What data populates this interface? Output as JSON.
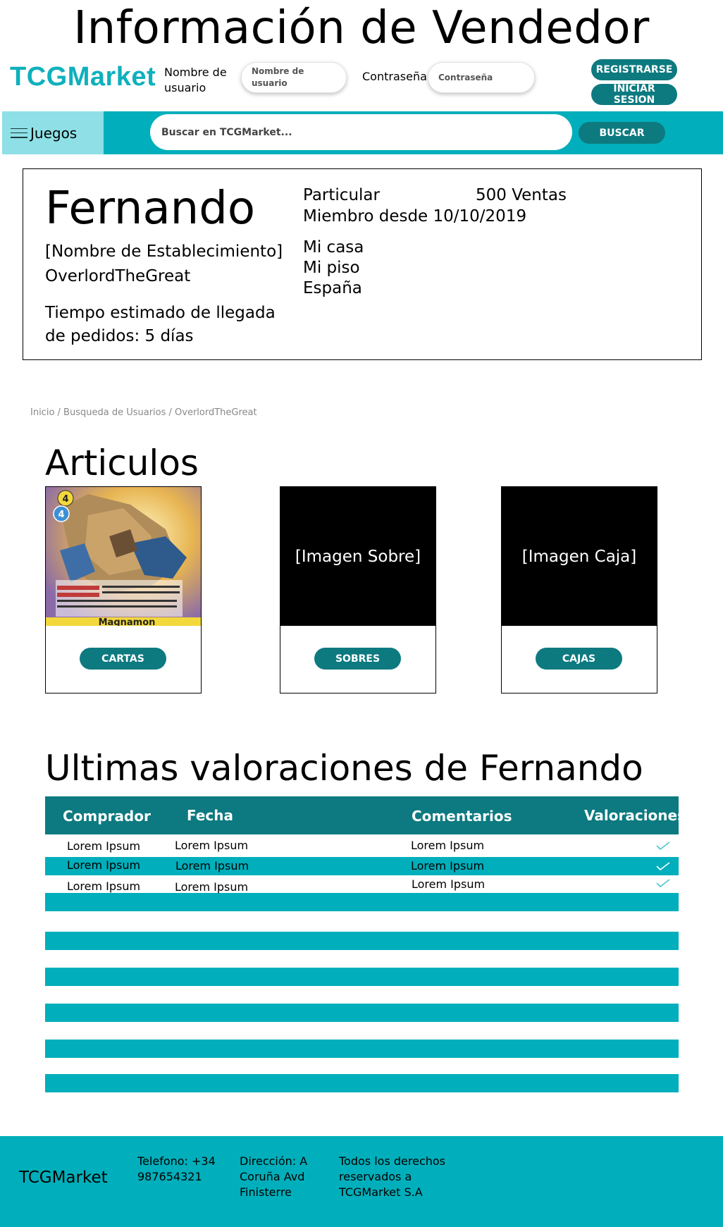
{
  "page_title": "Información de Vendedor",
  "header": {
    "brand": "TCGMarket",
    "username_label": "Nombre de usuario",
    "username_placeholder": "Nombre de usuario",
    "password_label": "Contraseña:",
    "password_placeholder": "Contraseña",
    "register_label": "REGISTRARSE",
    "login_label": "INICIAR SESION"
  },
  "nav": {
    "games_label": "Juegos",
    "search_placeholder": "Buscar en TCGMarket...",
    "search_button": "BUSCAR"
  },
  "seller": {
    "name": "Fernando",
    "establishment": "[Nombre de Establecimiento]",
    "username": "OverlordTheGreat",
    "eta": "Tiempo estimado de llegada de pedidos: 5 días",
    "type": "Particular",
    "sales": "500 Ventas",
    "member_since": "Miembro desde 10/10/2019",
    "address": [
      "Mi casa",
      "Mi piso",
      "España"
    ]
  },
  "breadcrumb": "Inicio / Busqueda de Usuarios / OverlordTheGreat",
  "articles": {
    "title": "Articulos",
    "cards": [
      {
        "image_label": "",
        "button": "CARTAS",
        "card_name": "Magnamon"
      },
      {
        "image_label": "[Imagen Sobre]",
        "button": "SOBRES"
      },
      {
        "image_label": "[Imagen Caja]",
        "button": "CAJAS"
      }
    ]
  },
  "ratings": {
    "title": "Ultimas valoraciones de Fernando",
    "columns": [
      "Comprador",
      "Fecha",
      "Comentarios",
      "Valoraciones"
    ],
    "rows": [
      {
        "buyer": "Lorem Ipsum",
        "date": "Lorem Ipsum",
        "comment": "Lorem Ipsum",
        "rating_icon": "check-icon"
      },
      {
        "buyer": "Lorem Ipsum",
        "date": "Lorem Ipsum",
        "comment": "Lorem Ipsum",
        "rating_icon": "check-icon"
      },
      {
        "buyer": "Lorem Ipsum",
        "date": "Lorem Ipsum",
        "comment": "Lorem Ipsum",
        "rating_icon": "check-icon"
      }
    ]
  },
  "footer": {
    "brand": "TCGMarket",
    "phone": "Telefono: +34 987654321",
    "address": "Dirección: A Coruña Avd Finisterre",
    "rights": "Todos los derechos reservados a TCGMarket S.A"
  },
  "colors": {
    "accent": "#00afbb",
    "dark_accent": "#0d7a80",
    "light_accent": "#8ee0e6",
    "brand": "#0fb0bd"
  }
}
